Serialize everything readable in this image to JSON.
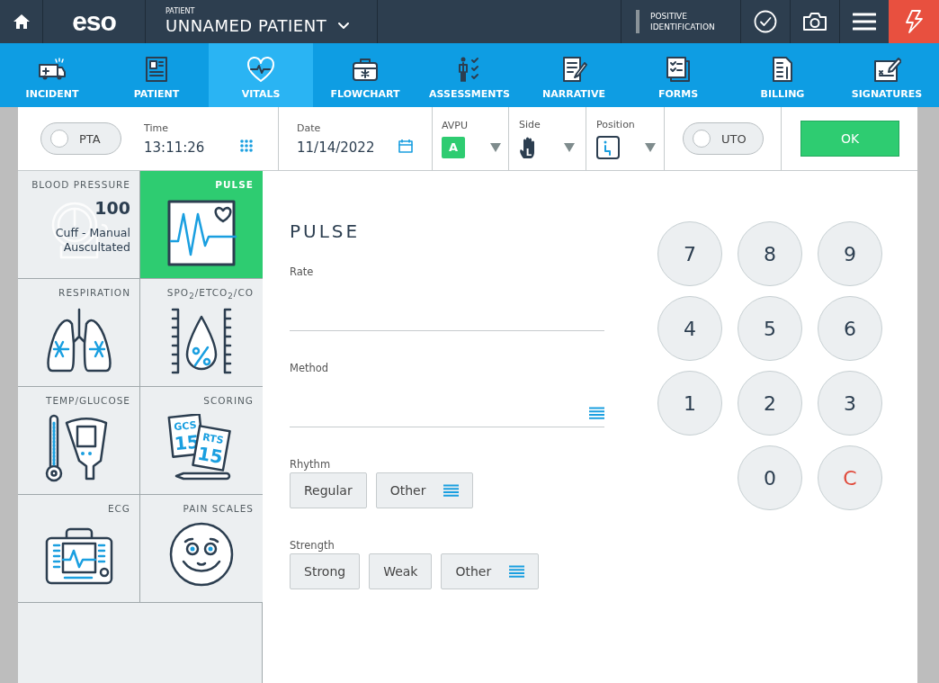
{
  "top_bar": {
    "logo": "eso",
    "patient_label": "PATIENT",
    "patient_name": "UNNAMED PATIENT",
    "identification": "POSITIVE IDENTIFICATION"
  },
  "tabs": [
    {
      "label": "INCIDENT",
      "selected": false
    },
    {
      "label": "PATIENT",
      "selected": false
    },
    {
      "label": "VITALS",
      "selected": true
    },
    {
      "label": "FLOWCHART",
      "selected": false
    },
    {
      "label": "ASSESSMENTS",
      "selected": false
    },
    {
      "label": "NARRATIVE",
      "selected": false
    },
    {
      "label": "FORMS",
      "selected": false
    },
    {
      "label": "BILLING",
      "selected": false
    },
    {
      "label": "SIGNATURES",
      "selected": false
    }
  ],
  "vitals_bar": {
    "pta": {
      "label": "PTA",
      "on": false
    },
    "time": {
      "label": "Time",
      "value": "13:11:26"
    },
    "date": {
      "label": "Date",
      "value": "11/14/2022"
    },
    "avpu": {
      "label": "AVPU",
      "value": "A"
    },
    "side": {
      "label": "Side",
      "value": "L"
    },
    "position": {
      "label": "Position"
    },
    "uto": {
      "label": "UTO",
      "on": false
    },
    "ok_button": "OK"
  },
  "tiles": [
    {
      "title": "BLOOD PRESSURE",
      "selected": false,
      "value": "100",
      "detail": "Cuff - Manual Auscultated"
    },
    {
      "title": "PULSE",
      "selected": true
    },
    {
      "title": "RESPIRATION",
      "selected": false
    },
    {
      "title": "SPO$_{2}$/ETCO$_{2}$/CO",
      "selected": false
    },
    {
      "title": "TEMP/GLUCOSE",
      "selected": false
    },
    {
      "title": "SCORING",
      "selected": false,
      "cards": [
        {
          "name": "GCS",
          "score": "15"
        },
        {
          "name": "RTS",
          "score": "15"
        }
      ]
    },
    {
      "title": "ECG",
      "selected": false
    },
    {
      "title": "PAIN SCALES",
      "selected": false
    }
  ],
  "pulse_form": {
    "title": "PULSE",
    "fields": [
      {
        "label": "Rate",
        "kind": "text"
      },
      {
        "label": "Method",
        "kind": "list"
      }
    ],
    "groups": [
      {
        "label": "Rhythm",
        "options": [
          {
            "label": "Regular",
            "kind": "plain",
            "selected": false
          },
          {
            "label": "Other",
            "kind": "list",
            "selected": false
          }
        ]
      },
      {
        "label": "Strength",
        "options": [
          {
            "label": "Strong",
            "kind": "plain",
            "selected": false
          },
          {
            "label": "Weak",
            "kind": "plain",
            "selected": false
          },
          {
            "label": "Other",
            "kind": "list",
            "selected": false
          }
        ]
      }
    ]
  },
  "keypad": [
    {
      "label": "7",
      "kind": "digit"
    },
    {
      "label": "8",
      "kind": "digit"
    },
    {
      "label": "9",
      "kind": "digit"
    },
    {
      "label": "4",
      "kind": "digit"
    },
    {
      "label": "5",
      "kind": "digit"
    },
    {
      "label": "6",
      "kind": "digit"
    },
    {
      "label": "1",
      "kind": "digit"
    },
    {
      "label": "2",
      "kind": "digit"
    },
    {
      "label": "3",
      "kind": "digit"
    },
    {
      "label": "0",
      "kind": "digit"
    },
    {
      "label": "C",
      "kind": "clear"
    }
  ]
}
